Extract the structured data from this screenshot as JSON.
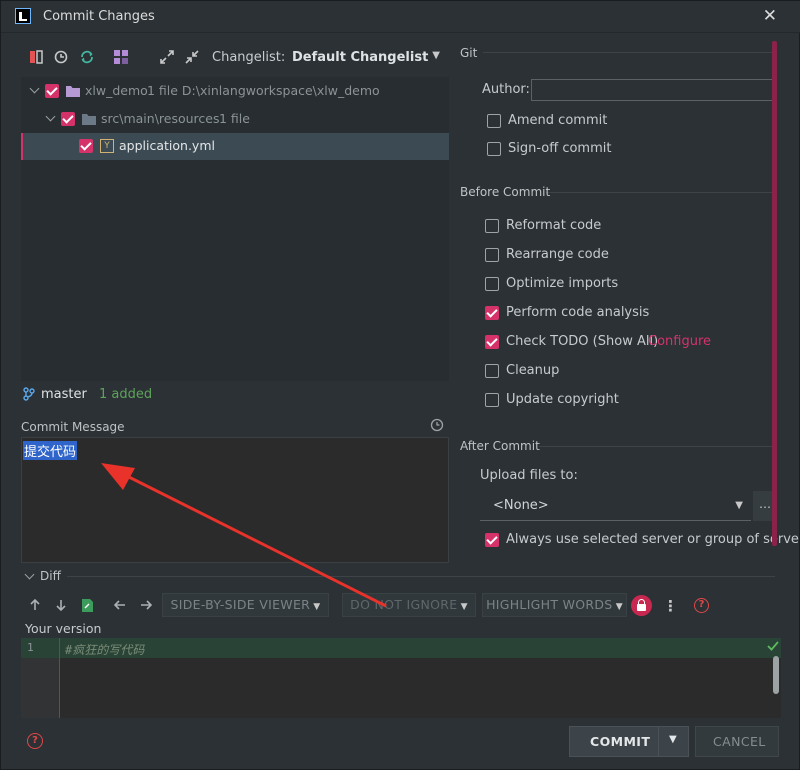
{
  "window": {
    "title": "Commit Changes",
    "close_glyph": "✕"
  },
  "toolbar": {
    "changelist_label": "Changelist:",
    "changelist_value": "Default Changelist"
  },
  "tree": [
    {
      "label": "xlw_demo",
      "meta": "1 file  D:\\xinlangworkspace\\xlw_demo"
    },
    {
      "label": "src\\main\\resources",
      "meta": "1 file"
    },
    {
      "label": "application.yml",
      "meta": ""
    }
  ],
  "status": {
    "branch": "master",
    "added": "1 added"
  },
  "commit_message": {
    "label": "Commit Message",
    "text": "提交代码"
  },
  "git": {
    "header": "Git",
    "author_label": "Author:",
    "author_value": "",
    "amend": "Amend commit",
    "signoff": "Sign-off commit"
  },
  "before_commit": {
    "header": "Before Commit",
    "options": [
      {
        "label": "Reformat code",
        "checked": false
      },
      {
        "label": "Rearrange code",
        "checked": false
      },
      {
        "label": "Optimize imports",
        "checked": false
      },
      {
        "label": "Perform code analysis",
        "checked": true
      },
      {
        "label": "Check TODO (Show All)",
        "checked": true
      },
      {
        "label": "Cleanup",
        "checked": false
      },
      {
        "label": "Update copyright",
        "checked": false
      }
    ],
    "configure_link": "Configure"
  },
  "after_commit": {
    "header": "After Commit",
    "upload_label": "Upload files to:",
    "upload_value": "<None>",
    "always_use": "Always use selected server or group of servers"
  },
  "diff": {
    "header": "Diff",
    "viewer": "SIDE-BY-SIDE VIEWER",
    "ignore": "DO NOT IGNORE",
    "highlight": "HIGHLIGHT WORDS",
    "your_version": "Your version",
    "line_no": "1",
    "line_text": "#疯狂的写代码"
  },
  "buttons": {
    "commit": "COMMIT",
    "cancel": "CANCEL"
  },
  "colors": {
    "accent": "#d6326a",
    "link": "#d6326a",
    "added_green": "#5fa35a",
    "selection": "#2f65ca"
  }
}
